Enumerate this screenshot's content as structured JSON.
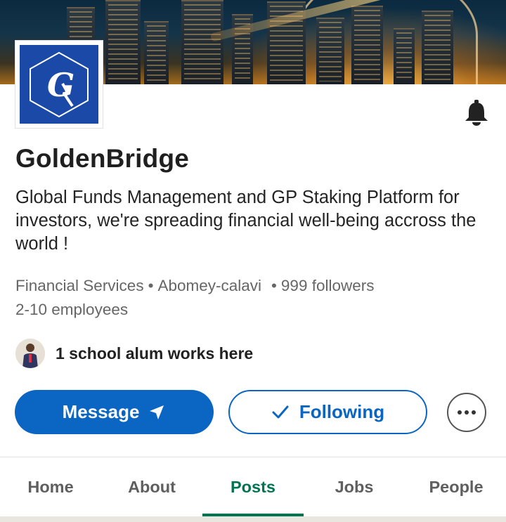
{
  "company": {
    "name": "GoldenBridge",
    "tagline": "Global Funds Management and GP Staking Platform for investors, we're spreading financial well-being accross the world !",
    "industry": "Financial Services",
    "location": "Abomey-calavi",
    "followers": "999 followers",
    "employees": "2-10 employees",
    "alum_text": "1 school alum works here",
    "logo_letters": "G"
  },
  "actions": {
    "message_label": "Message",
    "following_label": "Following"
  },
  "tabs": [
    {
      "label": "Home"
    },
    {
      "label": "About"
    },
    {
      "label": "Posts"
    },
    {
      "label": "Jobs"
    },
    {
      "label": "People"
    }
  ],
  "active_tab": "Posts",
  "icons": {
    "bell": "bell-icon",
    "send": "send-icon",
    "check": "check-icon",
    "more": "more-horizontal-icon"
  },
  "colors": {
    "primary": "#0a66c2",
    "active_tab": "#01754f",
    "logo_bg": "#1b49a8"
  }
}
